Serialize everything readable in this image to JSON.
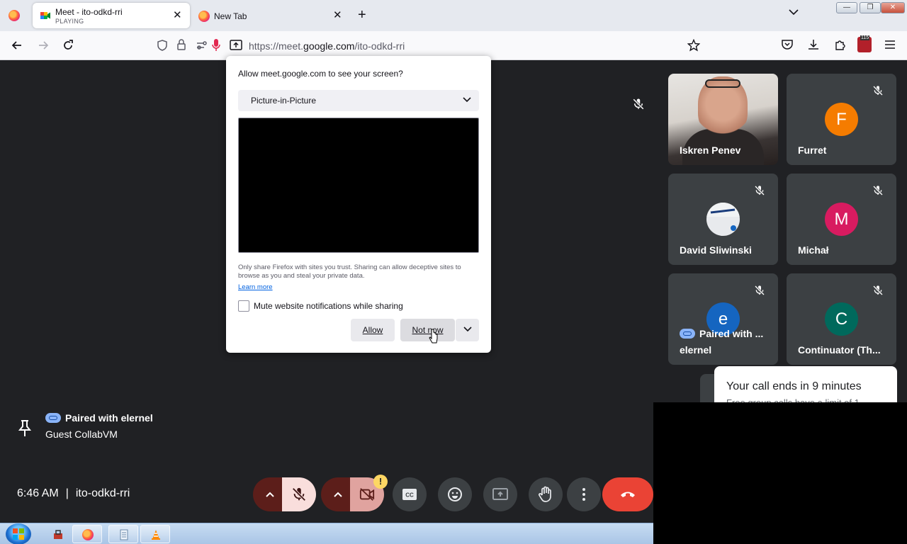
{
  "browser": {
    "tabs": [
      {
        "title": "Meet - ito-odkd-rri",
        "subtitle": "PLAYING",
        "active": true
      },
      {
        "title": "New Tab",
        "active": false
      }
    ],
    "url": {
      "prefix": "https://meet.",
      "domain": "google.com",
      "path": "/ito-odkd-rri"
    },
    "extension_badge": "115"
  },
  "popup": {
    "title": "Allow meet.google.com to see your screen?",
    "source_selected": "Picture-in-Picture",
    "warning": "Only share Firefox with sites you trust. Sharing can allow deceptive sites to browse as you and steal your private data.",
    "learn_more": "Learn more",
    "mute_label": "Mute website notifications while sharing",
    "mute_checked": false,
    "allow_label": "Allow",
    "not_now_label": "Not now"
  },
  "participants": [
    {
      "name": "Iskren Penev",
      "type": "video",
      "muted": false
    },
    {
      "name": "Furret",
      "initial": "F",
      "color": "#f57c00",
      "muted": true
    },
    {
      "name": "David Sliwinski",
      "initial": "",
      "color": "#e8eaed",
      "muted": true
    },
    {
      "name": "Michał",
      "initial": "M",
      "color": "#d81b60",
      "muted": true
    },
    {
      "name": "elernel",
      "paired": "Paired with ...",
      "initial": "e",
      "color": "#1565c0",
      "muted": true
    },
    {
      "name": "Continuator (Th...",
      "initial": "C",
      "color": "#00695c",
      "muted": true
    }
  ],
  "notice": {
    "title": "Your call ends in 9 minutes",
    "body": "Free group calls have a limit of 1..."
  },
  "guest": {
    "paired": "Paired with elernel",
    "name": "Guest CollabVM"
  },
  "meeting": {
    "time": "6:46 AM",
    "separator": "|",
    "code": "ito-odkd-rri"
  },
  "controls": {
    "video_warning": "!"
  },
  "colors": {
    "meet_bg": "#202124",
    "tile_bg": "#3c4043",
    "leave_red": "#ea4335",
    "mic_off_bg": "#f9dedc"
  }
}
